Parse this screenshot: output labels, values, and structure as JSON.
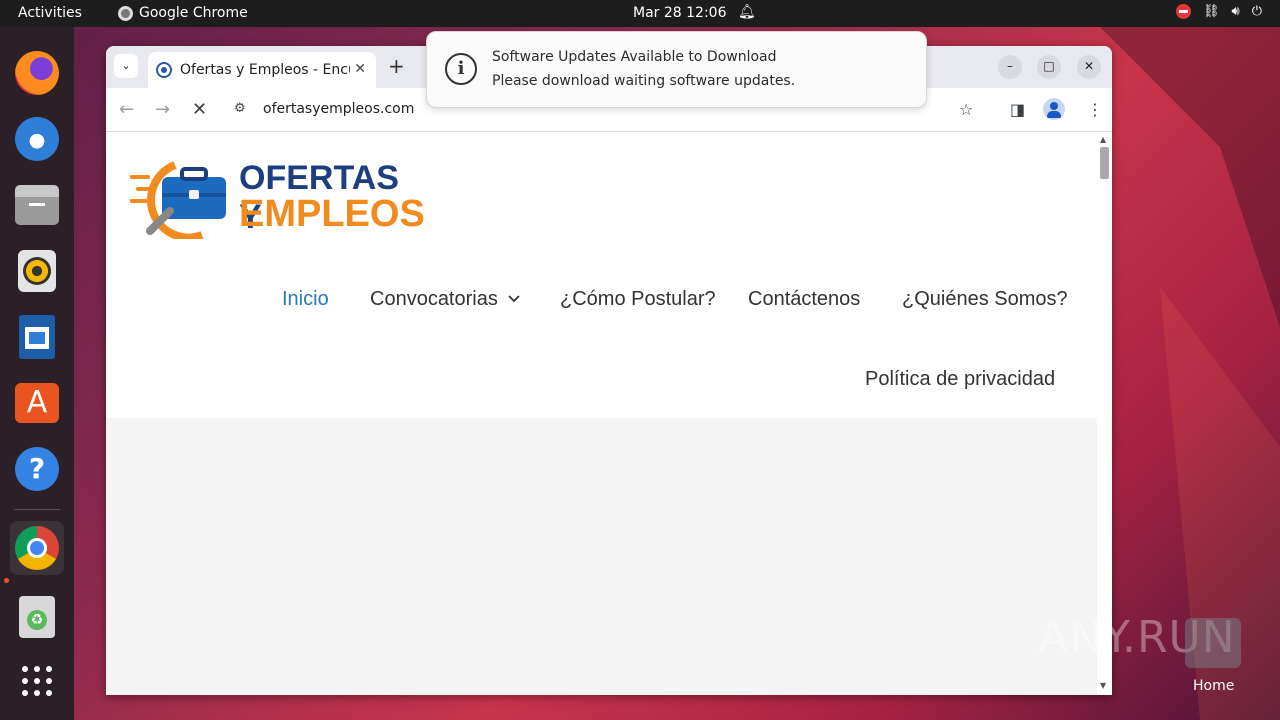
{
  "topbar": {
    "activities": "Activities",
    "app_name": "Google Chrome",
    "clock": "Mar 28  12:06"
  },
  "dock": {
    "items": [
      "Firefox",
      "Thunderbird",
      "Files",
      "Rhythmbox",
      "LibreOffice Writer",
      "Ubuntu Software",
      "Help",
      "Google Chrome",
      "Trash",
      "Show Applications"
    ]
  },
  "browser": {
    "tab_title": "Ofertas y Empleos - Encu",
    "url": "ofertasyempleos.com"
  },
  "site": {
    "logo_line1": "OFERTAS Y",
    "logo_line2": "EMPLEOS",
    "nav": {
      "inicio": "Inicio",
      "convocatorias": "Convocatorias",
      "como_postular": "¿Cómo Postular?",
      "contactenos": "Contáctenos",
      "quienes_somos": "¿Quiénes Somos?",
      "privacidad": "Política de privacidad"
    }
  },
  "notification": {
    "title": "Software Updates Available to Download",
    "body": "Please download waiting software updates."
  },
  "desktop": {
    "watermark": "ANY.RUN",
    "home_label": "Home"
  },
  "colors": {
    "accent": "#e95420",
    "logo_blue": "#1d3f80",
    "logo_orange": "#f28a1e",
    "nav_active": "#2b7ab0"
  }
}
